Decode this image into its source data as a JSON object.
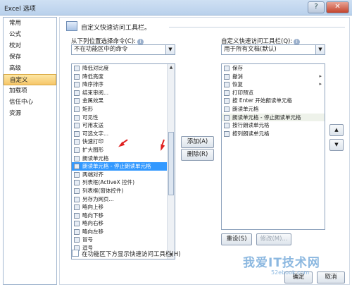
{
  "window": {
    "title": "Excel 选项"
  },
  "nav": {
    "items": [
      {
        "label": "常用",
        "selected": false
      },
      {
        "label": "公式",
        "selected": false
      },
      {
        "label": "校对",
        "selected": false
      },
      {
        "label": "保存",
        "selected": false
      },
      {
        "label": "高级",
        "selected": false
      },
      {
        "label": "自定义",
        "selected": true
      },
      {
        "label": "加载项",
        "selected": false
      },
      {
        "label": "信任中心",
        "selected": false
      },
      {
        "label": "资源",
        "selected": false
      }
    ]
  },
  "main": {
    "heading": "自定义快速访问工具栏。",
    "choose_from_label": "从下列位置选择命令(C):",
    "choose_from_value": "不在功能区中的命令",
    "customize_label": "自定义快速访问工具栏(Q):",
    "customize_value": "用于所有文档(默认)",
    "left_list": [
      {
        "label": "降低对比度",
        "sub": ""
      },
      {
        "label": "降低亮度",
        "sub": ""
      },
      {
        "label": "降序排序",
        "sub": ""
      },
      {
        "label": "结束审阅...",
        "sub": ""
      },
      {
        "label": "金属效果",
        "sub": ""
      },
      {
        "label": "矩形",
        "sub": ""
      },
      {
        "label": "可见性",
        "sub": ""
      },
      {
        "label": "可用发送",
        "sub": ""
      },
      {
        "label": "可选文字...",
        "sub": ""
      },
      {
        "label": "快速打印",
        "sub": ""
      },
      {
        "label": "扩大图形",
        "sub": ""
      },
      {
        "label": "朗读单元格",
        "sub": ""
      },
      {
        "label": "朗读单元格 - 停止朗读单元格",
        "sub": ""
      },
      {
        "label": "两端对齐",
        "sub": ""
      },
      {
        "label": "列表框(ActiveX 控件)",
        "sub": ""
      },
      {
        "label": "列表框(窗体控件)",
        "sub": ""
      },
      {
        "label": "另存为网页...",
        "sub": ""
      },
      {
        "label": "略向上移",
        "sub": ""
      },
      {
        "label": "略向下移",
        "sub": ""
      },
      {
        "label": "略向右移",
        "sub": ""
      },
      {
        "label": "略向左移",
        "sub": ""
      },
      {
        "label": "冒号",
        "sub": ""
      },
      {
        "label": "逗号",
        "sub": ""
      }
    ],
    "right_list": [
      {
        "label": "保存",
        "sub": ""
      },
      {
        "label": "撤消",
        "sub": "▸"
      },
      {
        "label": "恢复",
        "sub": "▸"
      },
      {
        "label": "打印预览",
        "sub": ""
      },
      {
        "label": "按 Enter 开始朗读单元格",
        "sub": ""
      },
      {
        "label": "朗读单元格",
        "sub": ""
      },
      {
        "label": "朗读单元格 - 停止朗读单元格",
        "sub": ""
      },
      {
        "label": "按行朗读单元格",
        "sub": ""
      },
      {
        "label": "按列朗读单元格",
        "sub": ""
      }
    ],
    "add_button": "添加(A) >>",
    "remove_button": "删除(R)",
    "reset_button": "重设(S)",
    "modify_button": "修改(M)...",
    "show_below_ribbon": "在功能区下方显示快速访问工具栏(H)"
  },
  "footer": {
    "ok_button": "确定",
    "cancel_button": "取消"
  },
  "watermark": {
    "text": "我爱IT技术网",
    "url": "52ebook.com"
  }
}
